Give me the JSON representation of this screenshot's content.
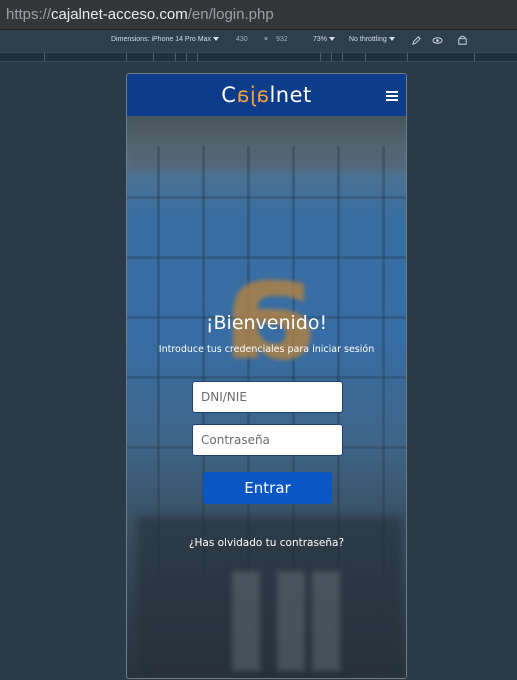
{
  "browser": {
    "url_scheme": "https://",
    "url_host": "cajalnet-acceso.com",
    "url_path": "/en/login.php"
  },
  "devtools": {
    "dimensions_label": "Dimensions: iPhone 14 Pro Max",
    "width_value": "430",
    "times_symbol": "×",
    "height_value": "932",
    "zoom_label": "73%",
    "throttling_label": "No throttling"
  },
  "site": {
    "logo_prefix": "C",
    "logo_mirror": "aja",
    "logo_suffix": "lnet",
    "header_color": "#0d3c8a",
    "welcome_title": "¡Bienvenido!",
    "subtitle": "Introduce tus credenciales para iniciar sesión",
    "dni_placeholder": "DNI/NIE",
    "password_placeholder": "Contraseña",
    "submit_label": "Entrar",
    "forgot_link": "¿Has olvidado tu contraseña?",
    "button_color": "#0a56c4"
  },
  "icons": {
    "menu": "hamburger-icon",
    "pen": "pen-icon",
    "eye": "eye-icon",
    "rotate": "rotate-icon"
  }
}
